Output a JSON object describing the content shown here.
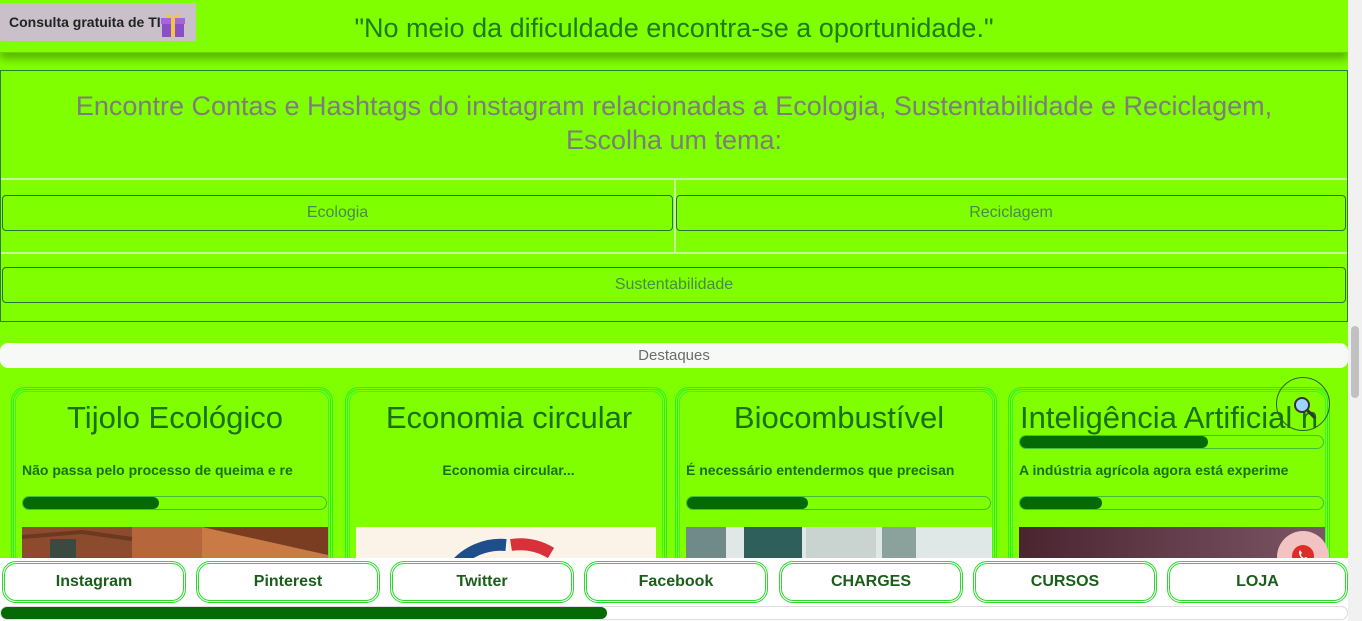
{
  "header": {
    "quote": "\"No meio da dificuldade encontra-se a oportunidade.\"",
    "badge": "Consulta gratuita de TI"
  },
  "topics": {
    "title": "Encontre Contas e Hashtags do instagram relacionadas a Ecologia, Sustentabilidade e Reciclagem, Escolha um tema:",
    "buttons": [
      "Ecologia",
      "Reciclagem",
      "Sustentabilidade"
    ]
  },
  "highlights": {
    "label": "Destaques",
    "cards": [
      {
        "title": "Tijolo Ecológico",
        "desc": "Não passa pelo processo de queima e re",
        "progress": 0.45
      },
      {
        "title": "Economia circular",
        "desc": "Economia circular...",
        "progress": 0
      },
      {
        "title": "Biocombustível",
        "desc": "É necessário entendermos que precisan",
        "progress": 0.4
      },
      {
        "title": "Inteligência Artificial n",
        "desc": "A indústria agrícola agora está experime",
        "progress": 0.27,
        "title_progress": 0.62
      }
    ]
  },
  "nav": {
    "items": [
      "Instagram",
      "Pinterest",
      "Twitter",
      "Facebook",
      "CHARGES",
      "CURSOS",
      "LOJA"
    ],
    "scroll_progress": 0.45
  },
  "icons": {
    "gift": "gift-icon",
    "search": "search-icon",
    "whatsapp": "whatsapp-icon"
  },
  "colors": {
    "background": "#7fff00",
    "text_green": "#1b6e1b",
    "progress": "#056a05"
  }
}
